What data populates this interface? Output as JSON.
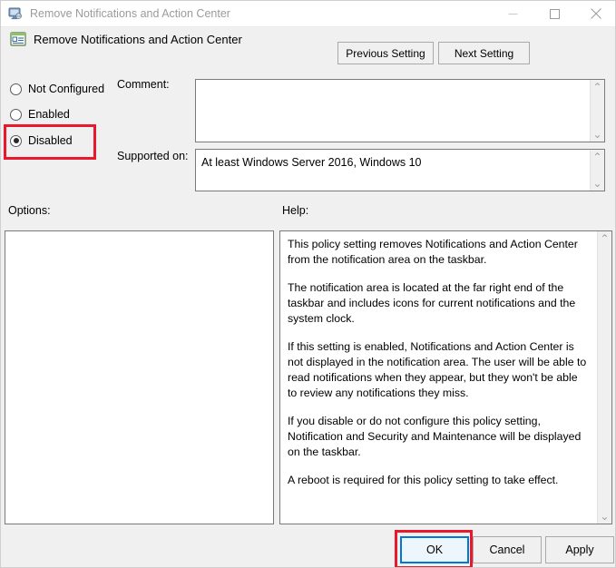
{
  "window": {
    "title": "Remove Notifications and Action Center",
    "title_icon": "computer-monitor-icon",
    "controls": {
      "minimize": "minimize-icon",
      "maximize": "maximize-icon",
      "close": "close-icon"
    }
  },
  "header": {
    "icon": "policy-window-icon",
    "title": "Remove Notifications and Action Center"
  },
  "nav": {
    "previous_label": "Previous Setting",
    "next_label": "Next Setting"
  },
  "state_options": [
    {
      "label": "Not Configured",
      "selected": false
    },
    {
      "label": "Enabled",
      "selected": false
    },
    {
      "label": "Disabled",
      "selected": true
    }
  ],
  "fields": {
    "comment_label": "Comment:",
    "comment_value": "",
    "supported_label": "Supported on:",
    "supported_value": "At least Windows Server 2016, Windows 10"
  },
  "panels": {
    "options_label": "Options:",
    "options_value": "",
    "help_label": "Help:",
    "help_paragraphs": [
      "This policy setting removes Notifications and Action Center from the notification area on the taskbar.",
      "The notification area is located at the far right end of the taskbar and includes icons for current notifications and the system clock.",
      "If this setting is enabled, Notifications and Action Center is not displayed in the notification area. The user will be able to read notifications when they appear, but they won't be able to review any notifications they miss.",
      "If you disable or do not configure this policy setting, Notification and Security and Maintenance will be displayed on the taskbar.",
      "A reboot is required for this policy setting to take effect."
    ]
  },
  "footer": {
    "ok_label": "OK",
    "cancel_label": "Cancel",
    "apply_label": "Apply"
  },
  "annotations": {
    "highlight_color": "#e8192c",
    "focus_color": "#0078d7",
    "highlighted_items": [
      "Disabled",
      "OK"
    ]
  },
  "scroll_arrows": {
    "up": "⌃",
    "down": "⌄"
  }
}
